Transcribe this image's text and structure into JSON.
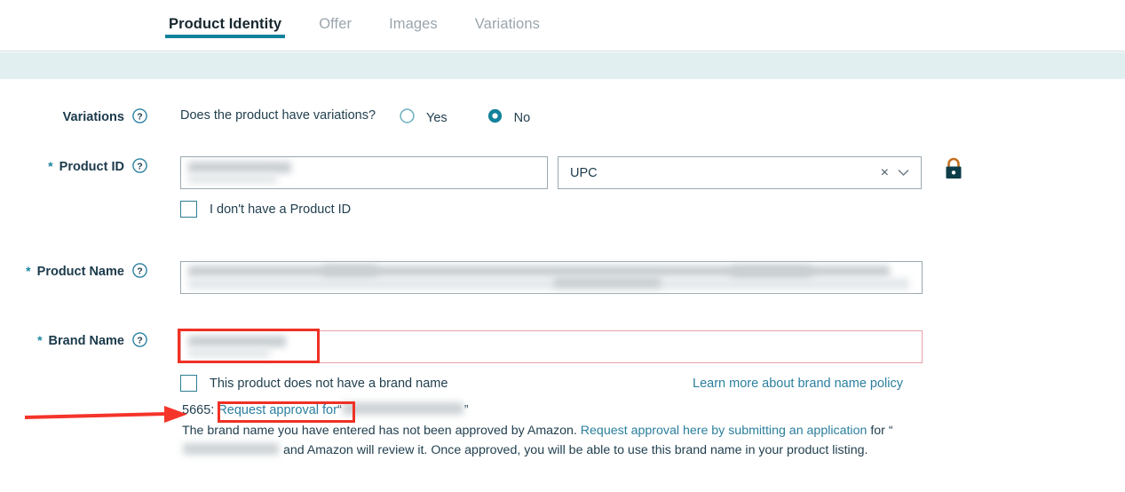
{
  "tabs": [
    {
      "label": "Product Identity",
      "active": true
    },
    {
      "label": "Offer",
      "active": false
    },
    {
      "label": "Images",
      "active": false
    },
    {
      "label": "Variations",
      "active": false
    }
  ],
  "fields": {
    "variations": {
      "label": "Variations",
      "question": "Does the product have variations?",
      "options": [
        {
          "label": "Yes",
          "selected": false
        },
        {
          "label": "No",
          "selected": true
        }
      ]
    },
    "product_id": {
      "label": "Product ID",
      "required": "*",
      "value": "",
      "type_select": {
        "value": "UPC",
        "clear_label": "×"
      },
      "checkbox": {
        "label": "I don't have a Product ID",
        "checked": false
      },
      "locked": true
    },
    "product_name": {
      "label": "Product Name",
      "required": "*",
      "value": ""
    },
    "brand_name": {
      "label": "Brand Name",
      "required": "*",
      "value": "",
      "error": true,
      "checkbox": {
        "label": "This product does not have a brand name",
        "checked": false
      },
      "policy_link": "Learn more about brand name policy"
    }
  },
  "error": {
    "code": "5665",
    "separator": ": ",
    "link_text": "Request approval for",
    "quote_open": "“",
    "quote_close": "”",
    "body_1": "The brand name you have entered has not been approved by Amazon. ",
    "body_link": "Request approval here by submitting an application",
    "body_2": " for “",
    "body_3": " and Amazon will review it. Once approved, you will be able to use this brand name in your product listing."
  },
  "colors": {
    "accent_teal": "#13829b",
    "link_blue": "#2b7f9e",
    "annotation_red": "#ef3124",
    "error_border": "#e9a0ab",
    "mint_band": "#e2eff0",
    "label_navy": "#1b3a4b"
  }
}
